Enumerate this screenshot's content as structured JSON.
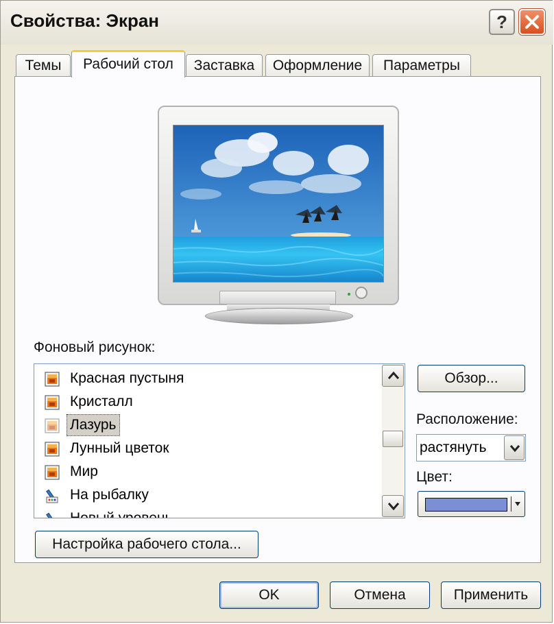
{
  "window": {
    "title": "Свойства: Экран",
    "help_label": "?"
  },
  "tabs": [
    {
      "label": "Темы"
    },
    {
      "label": "Рабочий стол"
    },
    {
      "label": "Заставка"
    },
    {
      "label": "Оформление"
    },
    {
      "label": "Параметры"
    }
  ],
  "active_tab": "Рабочий стол",
  "wallpaper": {
    "label": "Фоновый рисунок:",
    "items": [
      {
        "label": "Красная пустыня",
        "icon": "image-file-icon"
      },
      {
        "label": "Кристалл",
        "icon": "image-file-icon"
      },
      {
        "label": "Лазурь",
        "icon": "image-file-icon"
      },
      {
        "label": "Лунный цветок",
        "icon": "image-file-icon"
      },
      {
        "label": "Мир",
        "icon": "image-file-icon"
      },
      {
        "label": "На рыбалку",
        "icon": "paint-file-icon"
      },
      {
        "label": "Новый уровень",
        "icon": "paint-file-icon"
      }
    ],
    "selected": "Лазурь"
  },
  "browse_button": "Обзор...",
  "position": {
    "label": "Расположение:",
    "value": "растянуть"
  },
  "color": {
    "label": "Цвет:",
    "value_hex": "#7b8fd7"
  },
  "customize_button": "Настройка рабочего стола...",
  "footer": {
    "ok": "OK",
    "cancel": "Отмена",
    "apply": "Применить"
  },
  "colors": {
    "window_bg": "#ece9d8",
    "close_button": "#d8501f",
    "tab_highlight": "#ffc83c",
    "button_border": "#003c74"
  }
}
